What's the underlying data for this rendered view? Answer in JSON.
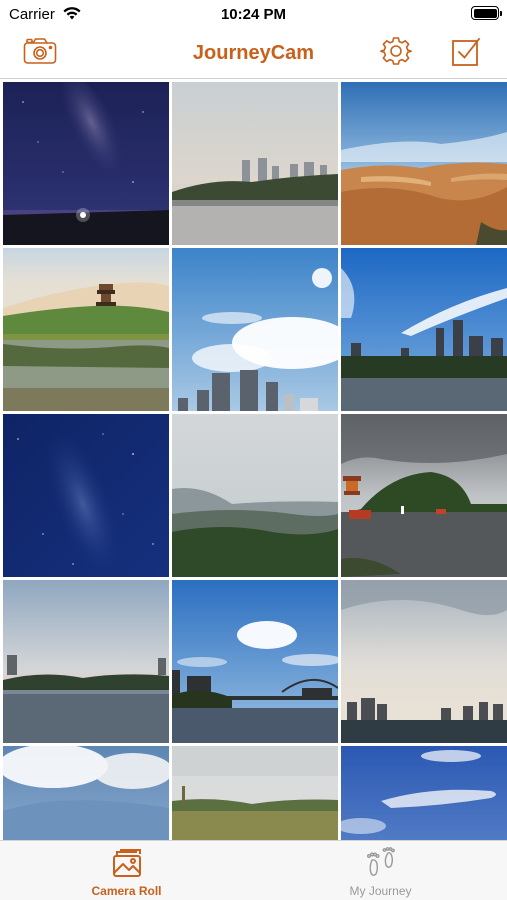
{
  "status_bar": {
    "carrier": "Carrier",
    "time": "10:24 PM",
    "wifi_icon": "wifi-icon",
    "battery_icon": "battery-icon"
  },
  "navbar": {
    "title": "JourneyCam",
    "accent_color": "#c8611c",
    "left_icon": "camera-icon",
    "right_icons": [
      "gear-icon",
      "checkbox-edit-icon"
    ]
  },
  "photos": [
    {
      "scene": "milky-way-night-shore"
    },
    {
      "scene": "city-skyline-lake-haze"
    },
    {
      "scene": "red-rock-hills-blue-sky"
    },
    {
      "scene": "pagoda-desert-lake-reflection"
    },
    {
      "scene": "skyscrapers-blue-sky-clouds"
    },
    {
      "scene": "city-skyline-lakefront-blue-sky"
    },
    {
      "scene": "starry-night-sky"
    },
    {
      "scene": "misty-forested-hills"
    },
    {
      "scene": "pavilion-hill-lake-boats"
    },
    {
      "scene": "river-overcast-dusk"
    },
    {
      "scene": "bridge-over-river-clouds"
    },
    {
      "scene": "cloudy-sky-city-shore"
    },
    {
      "scene": "clouds-over-mountain"
    },
    {
      "scene": "grassland-overcast"
    },
    {
      "scene": "blue-sky-wispy-clouds"
    }
  ],
  "tabbar": {
    "items": [
      {
        "label": "Camera Roll",
        "icon": "photos-icon",
        "active": true
      },
      {
        "label": "My Journey",
        "icon": "footprints-icon",
        "active": false
      }
    ],
    "active_color": "#c8611c",
    "inactive_color": "#9a9a9a"
  }
}
